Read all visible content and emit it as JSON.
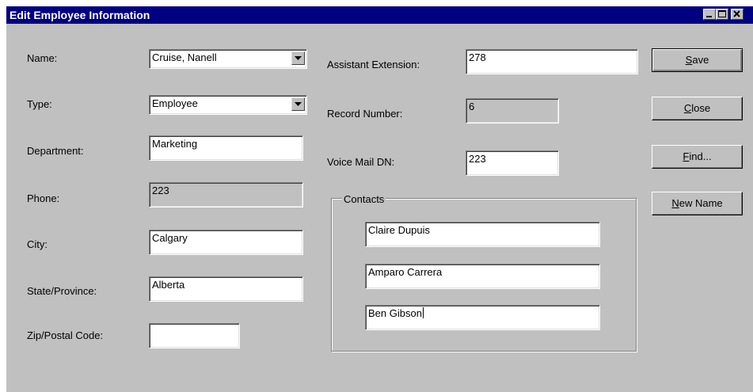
{
  "window": {
    "title": "Edit Employee Information"
  },
  "titlebar_buttons": [
    "minimize",
    "maximize",
    "close"
  ],
  "fields": {
    "name": {
      "label": "Name:",
      "value": "Cruise, Nanell"
    },
    "type": {
      "label": "Type:",
      "value": "Employee"
    },
    "department": {
      "label": "Department:",
      "value": "Marketing"
    },
    "phone": {
      "label": "Phone:",
      "value": "223"
    },
    "city": {
      "label": "City:",
      "value": "Calgary"
    },
    "state": {
      "label": "State/Province:",
      "value": "Alberta"
    },
    "zip": {
      "label": "Zip/Postal Code:",
      "value": ""
    },
    "assistant_ext": {
      "label": "Assistant Extension:",
      "value": "278"
    },
    "record_number": {
      "label": "Record Number:",
      "value": "6"
    },
    "voice_mail": {
      "label": "Voice Mail DN:",
      "value": "223"
    }
  },
  "contacts": {
    "label": "Contacts",
    "items": [
      "Claire Dupuis",
      "Amparo Carrera",
      "Ben Gibson"
    ]
  },
  "buttons": {
    "save": {
      "access": "S",
      "rest": "ave"
    },
    "close": {
      "access": "C",
      "rest": "lose"
    },
    "find": {
      "access": "F",
      "rest": "ind..."
    },
    "new_name": {
      "access": "N",
      "rest": "ew Name"
    }
  }
}
